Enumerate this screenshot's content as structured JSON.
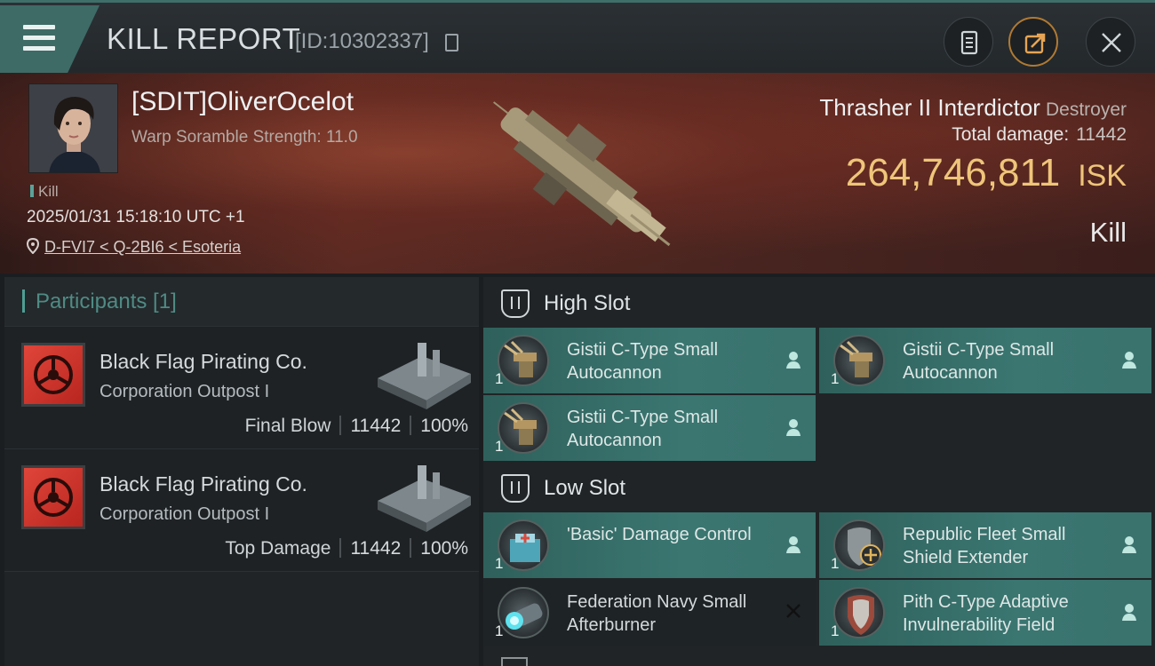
{
  "header": {
    "title": "KILL REPORT",
    "report_id": "[ID:10302337]",
    "icons": {
      "menu": "hamburger-icon",
      "copy": "copy-icon",
      "notes": "document-icon",
      "share": "share-icon",
      "close": "close-icon"
    }
  },
  "victim": {
    "pilot": "[SDIT]OliverOcelot",
    "warp_scramble": "Warp Soramble Strength: 11.0",
    "type": "Kill",
    "datetime": "2025/01/31 15:18:10 UTC +1",
    "location": "D-FVI7 < Q-2BI6 < Esoteria",
    "ship_name": "Thrasher II Interdictor",
    "ship_class": "Destroyer",
    "total_damage_label": "Total damage:",
    "total_damage": "11442",
    "isk_value": "264,746,811",
    "isk_unit": "ISK",
    "result": "Kill"
  },
  "participants": {
    "label": "Participants [1]",
    "rows": [
      {
        "name": "Black Flag Pirating Co.",
        "ship": "Corporation Outpost I",
        "role": "Final Blow",
        "damage": "11442",
        "percent": "100%"
      },
      {
        "name": "Black Flag Pirating Co.",
        "ship": "Corporation Outpost I",
        "role": "Top Damage",
        "damage": "11442",
        "percent": "100%"
      }
    ]
  },
  "fitting": {
    "high_slot": {
      "label": "High Slot",
      "modules": [
        {
          "name": "Gistii C-Type Small Autocannon",
          "qty": "1",
          "status": "person-icon"
        },
        {
          "name": "Gistii C-Type Small Autocannon",
          "qty": "1",
          "status": "person-icon"
        },
        {
          "name": "Gistii C-Type Small Autocannon",
          "qty": "1",
          "status": "person-icon"
        }
      ]
    },
    "low_slot": {
      "label": "Low Slot",
      "modules": [
        {
          "name": "'Basic' Damage Control",
          "qty": "1",
          "status": "person-icon"
        },
        {
          "name": "Republic Fleet Small Shield Extender",
          "qty": "1",
          "status": "person-icon"
        },
        {
          "name": "Federation Navy Small Afterburner",
          "qty": "1",
          "status": "destroyed-icon"
        },
        {
          "name": "Pith C-Type Adaptive Invulnerability Field",
          "qty": "1",
          "status": "person-icon"
        }
      ]
    }
  },
  "colors": {
    "accent": "#3b7671",
    "isk": "#efc57a",
    "corp": "#d2332b"
  }
}
